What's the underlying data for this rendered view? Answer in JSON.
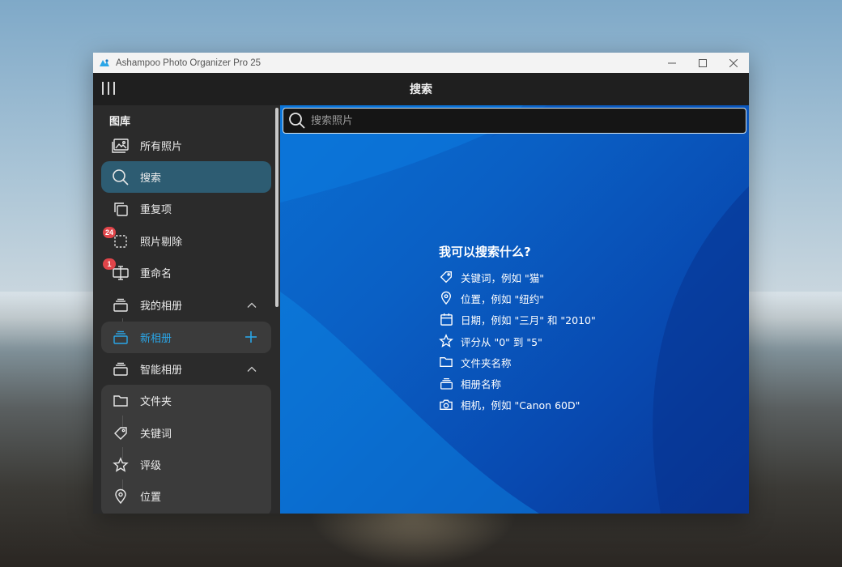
{
  "window": {
    "title": "Ashampoo Photo Organizer Pro 25"
  },
  "header": {
    "title": "搜索"
  },
  "sidebar": {
    "section_label": "图库",
    "items": {
      "all_photos": "所有照片",
      "search": "搜索",
      "duplicates": "重复项",
      "photo_cull": "照片剔除",
      "photo_cull_badge": "24",
      "rename": "重命名",
      "rename_badge": "1",
      "my_albums": "我的相册",
      "new_album": "新相册",
      "smart_albums": "智能相册",
      "folders": "文件夹",
      "keywords": "关键词",
      "ratings": "评级",
      "location": "位置"
    }
  },
  "search": {
    "placeholder": "搜索照片",
    "value": ""
  },
  "help": {
    "title": "我可以搜索什么?",
    "rows": [
      {
        "icon": "tag-icon",
        "text": "关键词，例如 \"猫\""
      },
      {
        "icon": "location-pin-icon",
        "text": "位置，例如 \"纽约\""
      },
      {
        "icon": "calendar-icon",
        "text": "日期，例如 \"三月\" 和 \"2010\""
      },
      {
        "icon": "star-icon",
        "text": "评分从 \"0\" 到 \"5\""
      },
      {
        "icon": "folder-icon",
        "text": "文件夹名称"
      },
      {
        "icon": "album-icon",
        "text": "相册名称"
      },
      {
        "icon": "camera-icon",
        "text": "相机，例如 \"Canon 60D\""
      }
    ]
  },
  "colors": {
    "accent": "#2aa6e8",
    "active_item": "#2d5c72",
    "badge": "#e0454a",
    "sidebar_bg": "#2b2b2b",
    "header_bg": "#1f1f1f"
  }
}
